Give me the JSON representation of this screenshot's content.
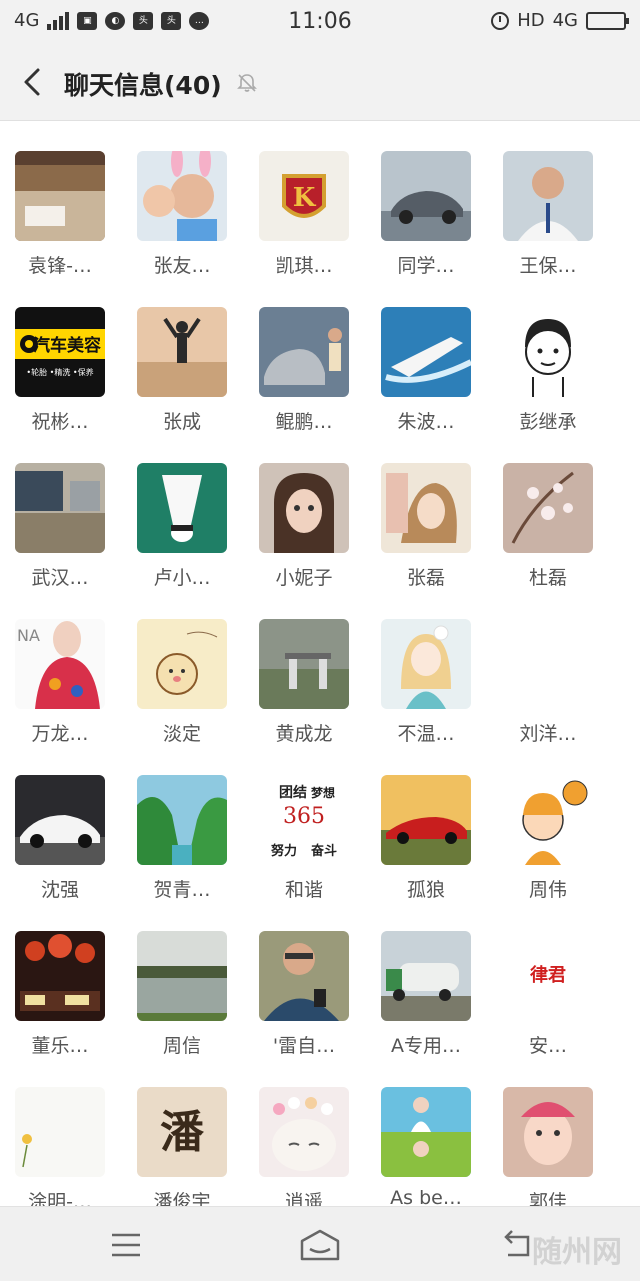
{
  "status_bar": {
    "network_left": "4G",
    "time": "11:06",
    "hd": "HD",
    "network_right": "4G"
  },
  "header": {
    "title": "聊天信息(40)"
  },
  "members": [
    {
      "name": "袁锋-…",
      "avatar": "room-photo"
    },
    {
      "name": "张友…",
      "avatar": "selfie-with-child"
    },
    {
      "name": "凯琪…",
      "avatar": "k-crest-logo"
    },
    {
      "name": "同学…",
      "avatar": "sports-car"
    },
    {
      "name": "王保…",
      "avatar": "man-office"
    },
    {
      "name": "祝彬…",
      "avatar": "car-beauty-logo",
      "avatar_text": "汽车美容"
    },
    {
      "name": "张成",
      "avatar": "beach-silhouette"
    },
    {
      "name": "鲲鹏…",
      "avatar": "man-with-car"
    },
    {
      "name": "朱波…",
      "avatar": "speedboat"
    },
    {
      "name": "彭继承",
      "avatar": "cartoon-boy"
    },
    {
      "name": "武汉…",
      "avatar": "flooded-street"
    },
    {
      "name": "卢小…",
      "avatar": "shuttlecock"
    },
    {
      "name": "小妮子",
      "avatar": "girl-portrait"
    },
    {
      "name": "张磊",
      "avatar": "anime-girl"
    },
    {
      "name": "杜磊",
      "avatar": "blossom"
    },
    {
      "name": "万龙…",
      "avatar": "girl-floral-dress"
    },
    {
      "name": "淡定",
      "avatar": "cartoon-bear"
    },
    {
      "name": "黄成龙",
      "avatar": "landscape-gate"
    },
    {
      "name": "不温…",
      "avatar": "cartoon-girl-flower"
    },
    {
      "name": "刘洋…",
      "avatar": "blank"
    },
    {
      "name": "沈强",
      "avatar": "white-sportscar"
    },
    {
      "name": "贺青…",
      "avatar": "green-valley"
    },
    {
      "name": "和谐",
      "avatar": "motto-text",
      "avatar_text": "365"
    },
    {
      "name": "孤狼",
      "avatar": "red-sportscar"
    },
    {
      "name": "周伟",
      "avatar": "cartoon-basketball"
    },
    {
      "name": "董乐…",
      "avatar": "night-lanterns"
    },
    {
      "name": "周信",
      "avatar": "lake-view"
    },
    {
      "name": "'雷自…",
      "avatar": "man-with-phone"
    },
    {
      "name": "A专用…",
      "avatar": "water-truck"
    },
    {
      "name": "安…",
      "avatar": "law-logo",
      "avatar_text": "律君"
    },
    {
      "name": "涂明-…",
      "avatar": "flower-sketch"
    },
    {
      "name": "潘俊宇",
      "avatar": "calligraphy",
      "avatar_text": "潘"
    },
    {
      "name": "逍遥",
      "avatar": "cat-flower-crown"
    },
    {
      "name": "As be…",
      "avatar": "girl-meadow"
    },
    {
      "name": "郭佳",
      "avatar": "baby-pink"
    }
  ],
  "watermark": "随州网"
}
